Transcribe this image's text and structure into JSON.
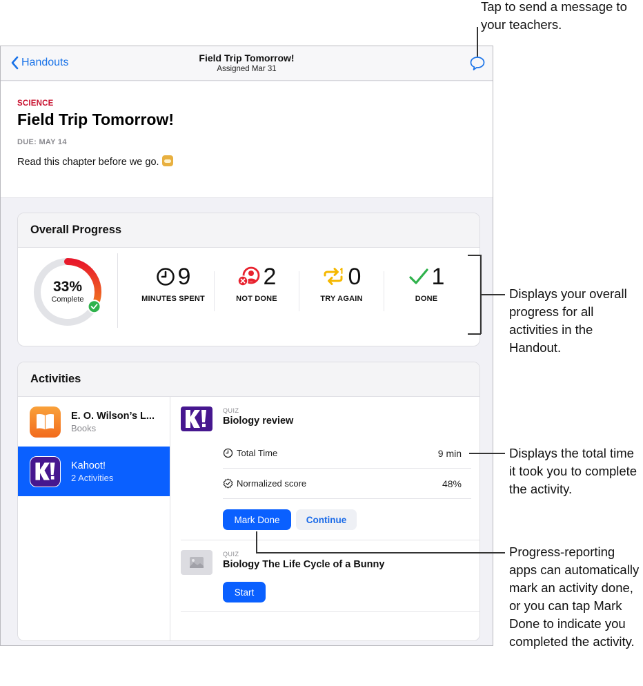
{
  "navbar": {
    "back_label": "Handouts",
    "title": "Field Trip Tomorrow!",
    "subtitle": "Assigned Mar 31"
  },
  "handout": {
    "subject": "SCIENCE",
    "title": "Field Trip Tomorrow!",
    "due": "DUE: MAY 14",
    "description": "Read this chapter before we go."
  },
  "progress": {
    "heading": "Overall Progress",
    "percent_complete": 33,
    "percent_label": "33%",
    "complete_label": "Complete",
    "stats": [
      {
        "icon": "clock-icon",
        "value": "9",
        "label": "MINUTES SPENT",
        "color": "#111111"
      },
      {
        "icon": "not-done-icon",
        "value": "2",
        "label": "NOT DONE",
        "color": "#e8222e"
      },
      {
        "icon": "try-again-icon",
        "value": "0",
        "label": "TRY AGAIN",
        "color": "#f5b800"
      },
      {
        "icon": "checkmark-icon",
        "value": "1",
        "label": "DONE",
        "color": "#2fb24c"
      }
    ]
  },
  "activities": {
    "heading": "Activities",
    "apps": [
      {
        "name": "E. O. Wilson’s L...",
        "subtitle": "Books",
        "selected": false
      },
      {
        "name": "Kahoot!",
        "subtitle": "2 Activities",
        "selected": true
      }
    ],
    "items": [
      {
        "tag": "QUIZ",
        "title": "Biology review",
        "metrics": [
          {
            "label": "Total Time",
            "value": "9 min"
          },
          {
            "label": "Normalized score",
            "value": "48%"
          }
        ],
        "buttons": {
          "primary": "Mark Done",
          "secondary": "Continue"
        }
      },
      {
        "tag": "QUIZ",
        "title": "Biology The Life Cycle of a Bunny",
        "buttons": {
          "primary": "Start"
        }
      }
    ]
  },
  "callouts": {
    "message": "Tap to send a message to your teachers.",
    "progress": "Displays your overall progress for all activities in the Handout.",
    "time": "Displays the total time it took you to complete the activity.",
    "mark_done": "Progress-reporting apps can automatically mark an activity done, or you can tap Mark Done to indicate you completed the activity."
  },
  "colors": {
    "accent": "#0a60ff",
    "subject": "#c8102e",
    "kahoot": "#46178f",
    "books": "#f57c1f"
  }
}
